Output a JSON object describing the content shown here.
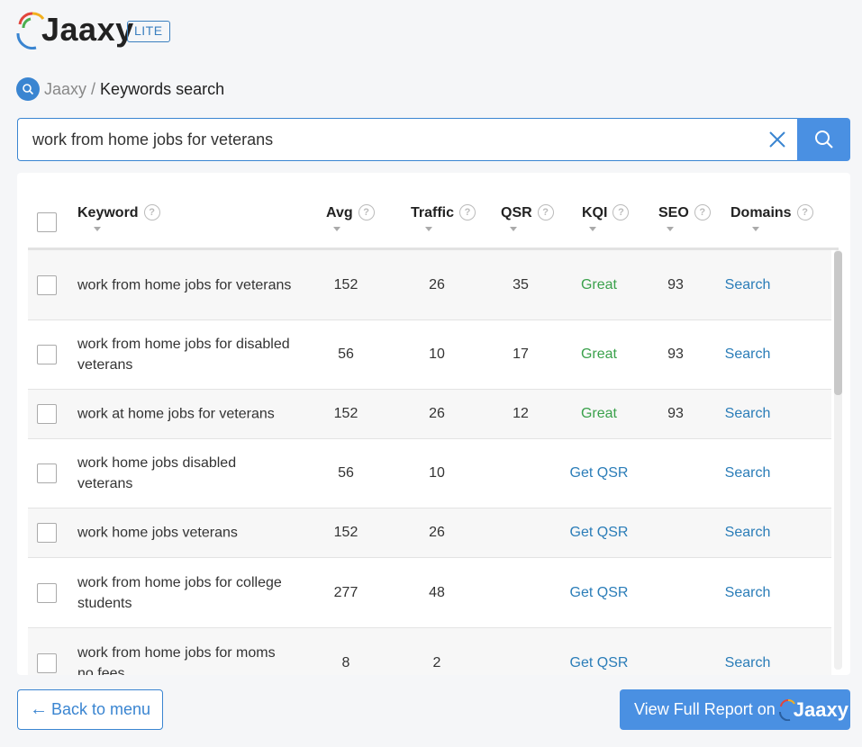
{
  "header": {
    "logo_text": "Jaaxy",
    "badge": "LITE"
  },
  "breadcrumb": {
    "root": "Jaaxy",
    "separator": "/",
    "current": "Keywords search"
  },
  "search": {
    "value": "work from home jobs for veterans"
  },
  "table": {
    "columns": {
      "keyword": "Keyword",
      "avg": "Avg",
      "traffic": "Traffic",
      "qsr": "QSR",
      "kqi": "KQI",
      "seo": "SEO",
      "domains": "Domains"
    },
    "help_glyph": "?",
    "rows": [
      {
        "keyword": "work from home jobs for veterans",
        "avg": "152",
        "traffic": "26",
        "qsr": "35",
        "kqi": "Great",
        "seo": "93",
        "domains": "Search"
      },
      {
        "keyword": "work from home jobs for disabled veterans",
        "avg": "56",
        "traffic": "10",
        "qsr": "17",
        "kqi": "Great",
        "seo": "93",
        "domains": "Search"
      },
      {
        "keyword": "work at home jobs for veterans",
        "avg": "152",
        "traffic": "26",
        "qsr": "12",
        "kqi": "Great",
        "seo": "93",
        "domains": "Search"
      },
      {
        "keyword": "work home jobs disabled veterans",
        "avg": "56",
        "traffic": "10",
        "qsr": "",
        "kqi": "Get QSR",
        "seo": "",
        "domains": "Search"
      },
      {
        "keyword": "work home jobs veterans",
        "avg": "152",
        "traffic": "26",
        "qsr": "",
        "kqi": "Get QSR",
        "seo": "",
        "domains": "Search"
      },
      {
        "keyword": "work from home jobs for college students",
        "avg": "277",
        "traffic": "48",
        "qsr": "",
        "kqi": "Get QSR",
        "seo": "",
        "domains": "Search"
      },
      {
        "keyword": "work from home jobs for moms no fees",
        "avg": "8",
        "traffic": "2",
        "qsr": "",
        "kqi": "Get QSR",
        "seo": "",
        "domains": "Search"
      }
    ]
  },
  "footer": {
    "back_arrow": "←",
    "back_label": "Back to menu",
    "report_label": "View Full Report on",
    "report_logo_text": "Jaaxy"
  },
  "colors": {
    "accent": "#4a90e2",
    "great": "#3aa14b",
    "link": "#2b7db8"
  },
  "icons": [
    "jaaxy-logo-icon",
    "search-icon",
    "close-icon",
    "help-icon",
    "sort-caret-icon",
    "arrow-left-icon"
  ]
}
